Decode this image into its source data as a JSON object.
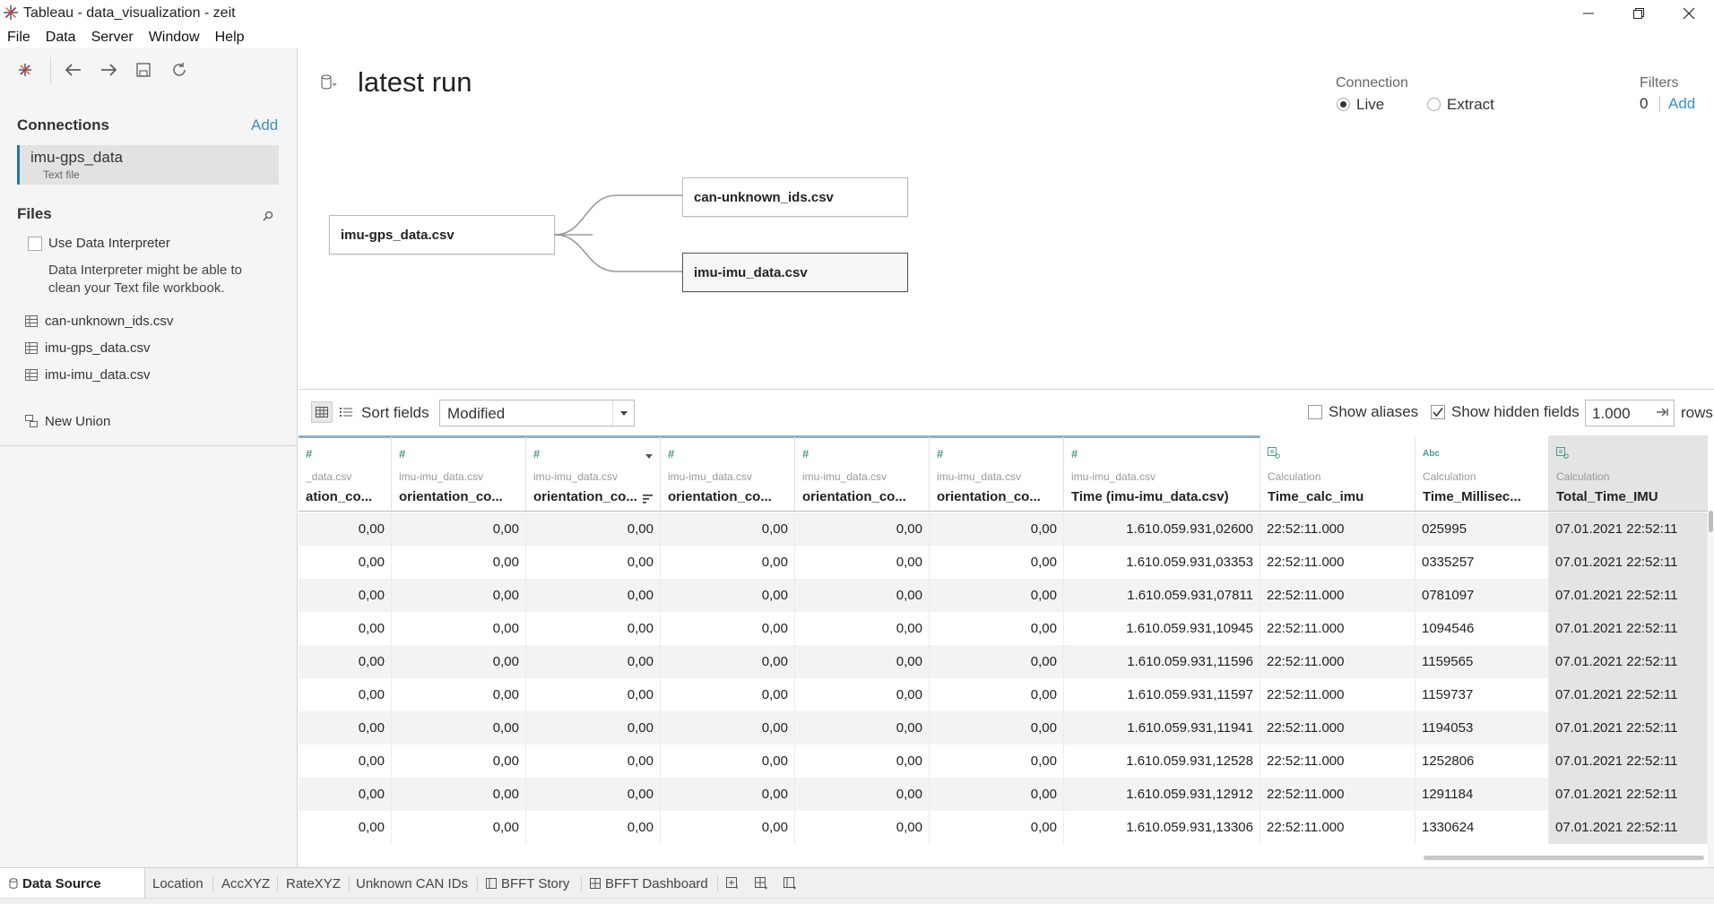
{
  "window": {
    "title": "Tableau - data_visualization - zeit"
  },
  "menu": [
    "File",
    "Data",
    "Server",
    "Window",
    "Help"
  ],
  "left": {
    "connections_title": "Connections",
    "connections_add": "Add",
    "connection": {
      "name": "imu-gps_data",
      "type": "Text file"
    },
    "files_title": "Files",
    "interpreter_label": "Use Data Interpreter",
    "interpreter_desc": "Data Interpreter might be able to clean your Text file workbook.",
    "files": [
      "can-unknown_ids.csv",
      "imu-gps_data.csv",
      "imu-imu_data.csv"
    ],
    "new_union": "New Union"
  },
  "canvas": {
    "datasource_name": "latest run",
    "connection_label": "Connection",
    "live_label": "Live",
    "extract_label": "Extract",
    "filters_label": "Filters",
    "filters_count": "0",
    "filters_add": "Add",
    "tables": {
      "primary": "imu-gps_data.csv",
      "join1": "can-unknown_ids.csv",
      "join2": "imu-imu_data.csv"
    }
  },
  "gridbar": {
    "sort_label": "Sort fields",
    "sort_value": "Modified",
    "show_aliases": "Show aliases",
    "show_hidden": "Show hidden fields",
    "rows_value": "1.000",
    "rows_label": "rows"
  },
  "grid": {
    "columns": [
      {
        "type": "#",
        "source": "_data.csv",
        "name": "ation_co..."
      },
      {
        "type": "#",
        "source": "imu-imu_data.csv",
        "name": "orientation_co..."
      },
      {
        "type": "#",
        "source": "imu-imu_data.csv",
        "name": "orientation_co..."
      },
      {
        "type": "#",
        "source": "imu-imu_data.csv",
        "name": "orientation_co..."
      },
      {
        "type": "#",
        "source": "imu-imu_data.csv",
        "name": "orientation_co..."
      },
      {
        "type": "#",
        "source": "imu-imu_data.csv",
        "name": "orientation_co..."
      },
      {
        "type": "#",
        "source": "imu-imu_data.csv",
        "name": "Time (imu-imu_data.csv)"
      },
      {
        "type": "=",
        "source": "Calculation",
        "name": "Time_calc_imu"
      },
      {
        "type": "Abc",
        "source": "Calculation",
        "name": "Time_Millisec..."
      },
      {
        "type": "=",
        "source": "Calculation",
        "name": "Total_Time_IMU"
      }
    ],
    "rows": [
      [
        "0,00",
        "0,00",
        "0,00",
        "0,00",
        "0,00",
        "0,00",
        "1.610.059.931,02600",
        "22:52:11.000",
        "025995",
        "07.01.2021 22:52:11"
      ],
      [
        "0,00",
        "0,00",
        "0,00",
        "0,00",
        "0,00",
        "0,00",
        "1.610.059.931,03353",
        "22:52:11.000",
        "0335257",
        "07.01.2021 22:52:11"
      ],
      [
        "0,00",
        "0,00",
        "0,00",
        "0,00",
        "0,00",
        "0,00",
        "1.610.059.931,07811",
        "22:52:11.000",
        "0781097",
        "07.01.2021 22:52:11"
      ],
      [
        "0,00",
        "0,00",
        "0,00",
        "0,00",
        "0,00",
        "0,00",
        "1.610.059.931,10945",
        "22:52:11.000",
        "1094546",
        "07.01.2021 22:52:11"
      ],
      [
        "0,00",
        "0,00",
        "0,00",
        "0,00",
        "0,00",
        "0,00",
        "1.610.059.931,11596",
        "22:52:11.000",
        "1159565",
        "07.01.2021 22:52:11"
      ],
      [
        "0,00",
        "0,00",
        "0,00",
        "0,00",
        "0,00",
        "0,00",
        "1.610.059.931,11597",
        "22:52:11.000",
        "1159737",
        "07.01.2021 22:52:11"
      ],
      [
        "0,00",
        "0,00",
        "0,00",
        "0,00",
        "0,00",
        "0,00",
        "1.610.059.931,11941",
        "22:52:11.000",
        "1194053",
        "07.01.2021 22:52:11"
      ],
      [
        "0,00",
        "0,00",
        "0,00",
        "0,00",
        "0,00",
        "0,00",
        "1.610.059.931,12528",
        "22:52:11.000",
        "1252806",
        "07.01.2021 22:52:11"
      ],
      [
        "0,00",
        "0,00",
        "0,00",
        "0,00",
        "0,00",
        "0,00",
        "1.610.059.931,12912",
        "22:52:11.000",
        "1291184",
        "07.01.2021 22:52:11"
      ],
      [
        "0,00",
        "0,00",
        "0,00",
        "0,00",
        "0,00",
        "0,00",
        "1.610.059.931,13306",
        "22:52:11.000",
        "1330624",
        "07.01.2021 22:52:11"
      ]
    ]
  },
  "tabs": [
    "Data Source",
    "Location",
    "AccXYZ",
    "RateXYZ",
    "Unknown CAN IDs",
    "BFFT Story",
    "BFFT Dashboard"
  ],
  "colors": {
    "accent": "#3d8fc4",
    "connection_bar": "#1f77b4",
    "field_icon": "#4a9a8f"
  }
}
